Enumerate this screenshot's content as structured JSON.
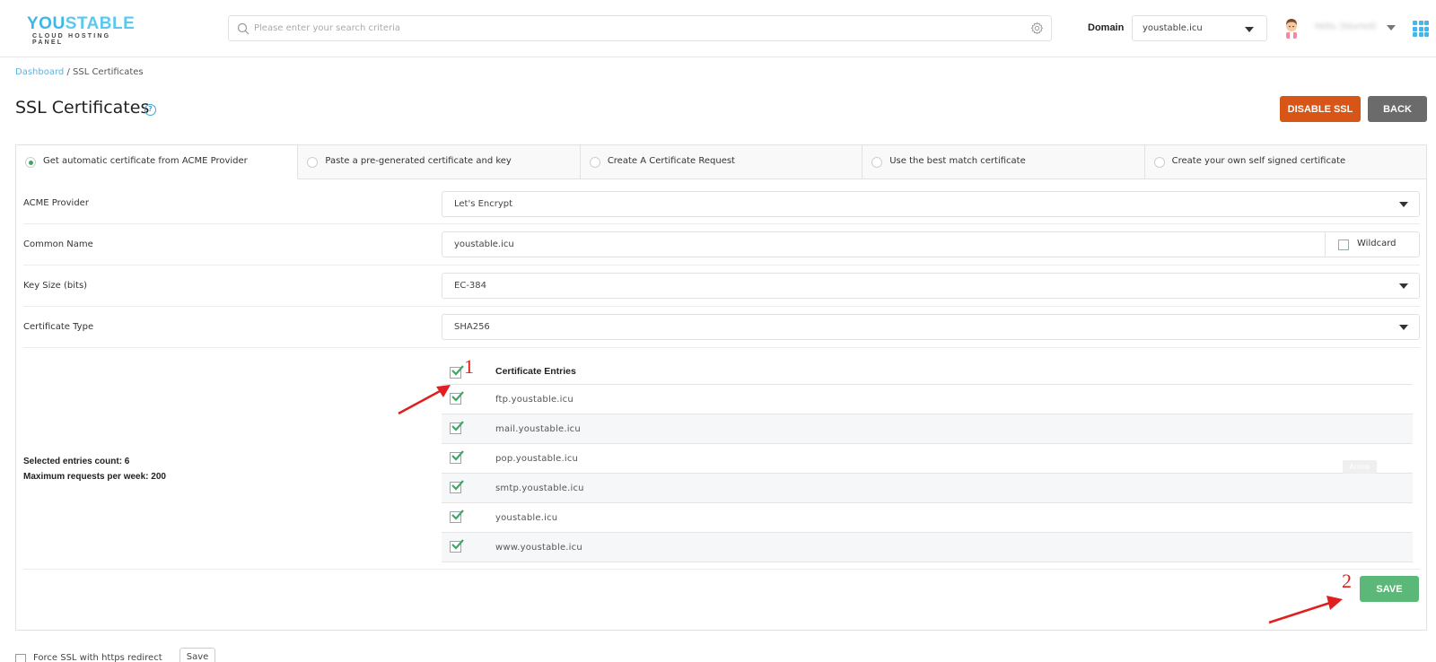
{
  "header": {
    "logo": {
      "brand_part1": "YOU",
      "brand_part2": "STABLE",
      "tagline": "CLOUD HOSTING PANEL"
    },
    "search": {
      "placeholder": "Please enter your search criteria",
      "value": ""
    },
    "domain_label": "Domain",
    "domain_selected": "youstable.icu",
    "user_name": "Hello, [blurred]"
  },
  "breadcrumb": {
    "parent": "Dashboard",
    "separator": " / ",
    "current": "SSL Certificates"
  },
  "page": {
    "title": "SSL Certificates",
    "help_icon": "?",
    "buttons": {
      "disable_ssl": "DISABLE SSL",
      "back": "BACK",
      "save": "SAVE"
    }
  },
  "tabs": [
    {
      "label": "Get automatic certificate from ACME Provider",
      "selected": true
    },
    {
      "label": "Paste a pre-generated certificate and key",
      "selected": false
    },
    {
      "label": "Create A Certificate Request",
      "selected": false
    },
    {
      "label": "Use the best match certificate",
      "selected": false
    },
    {
      "label": "Create your own self signed certificate",
      "selected": false
    }
  ],
  "form": {
    "acme_provider": {
      "label": "ACME Provider",
      "value": "Let's Encrypt"
    },
    "common_name": {
      "label": "Common Name",
      "value": "youstable.icu",
      "wildcard_label": "Wildcard",
      "wildcard_checked": false
    },
    "key_size": {
      "label": "Key Size (bits)",
      "value": "EC-384"
    },
    "certificate_type": {
      "label": "Certificate Type",
      "value": "SHA256"
    }
  },
  "entries": {
    "header": "Certificate Entries",
    "select_all_checked": true,
    "items": [
      {
        "name": "ftp.youstable.icu",
        "checked": true
      },
      {
        "name": "mail.youstable.icu",
        "checked": true
      },
      {
        "name": "pop.youstable.icu",
        "checked": true
      },
      {
        "name": "smtp.youstable.icu",
        "checked": true
      },
      {
        "name": "youstable.icu",
        "checked": true
      },
      {
        "name": "www.youstable.icu",
        "checked": true
      }
    ],
    "selected_count_text": "Selected entries count: 6",
    "max_requests_text": "Maximum requests per week: 200"
  },
  "tooltip": "Arrow",
  "annotations": {
    "step1": "1",
    "step2": "2"
  },
  "footer": {
    "force_ssl_label": "Force SSL with https redirect",
    "force_ssl_checked": false,
    "save_label": "Save"
  },
  "colors": {
    "accent_blue": "#3ea6dd",
    "disable_button": "#d65517",
    "back_button": "#6b6b6b",
    "save_button": "#5cb878",
    "check_green": "#3fa665",
    "annotation_red": "#e02020"
  }
}
